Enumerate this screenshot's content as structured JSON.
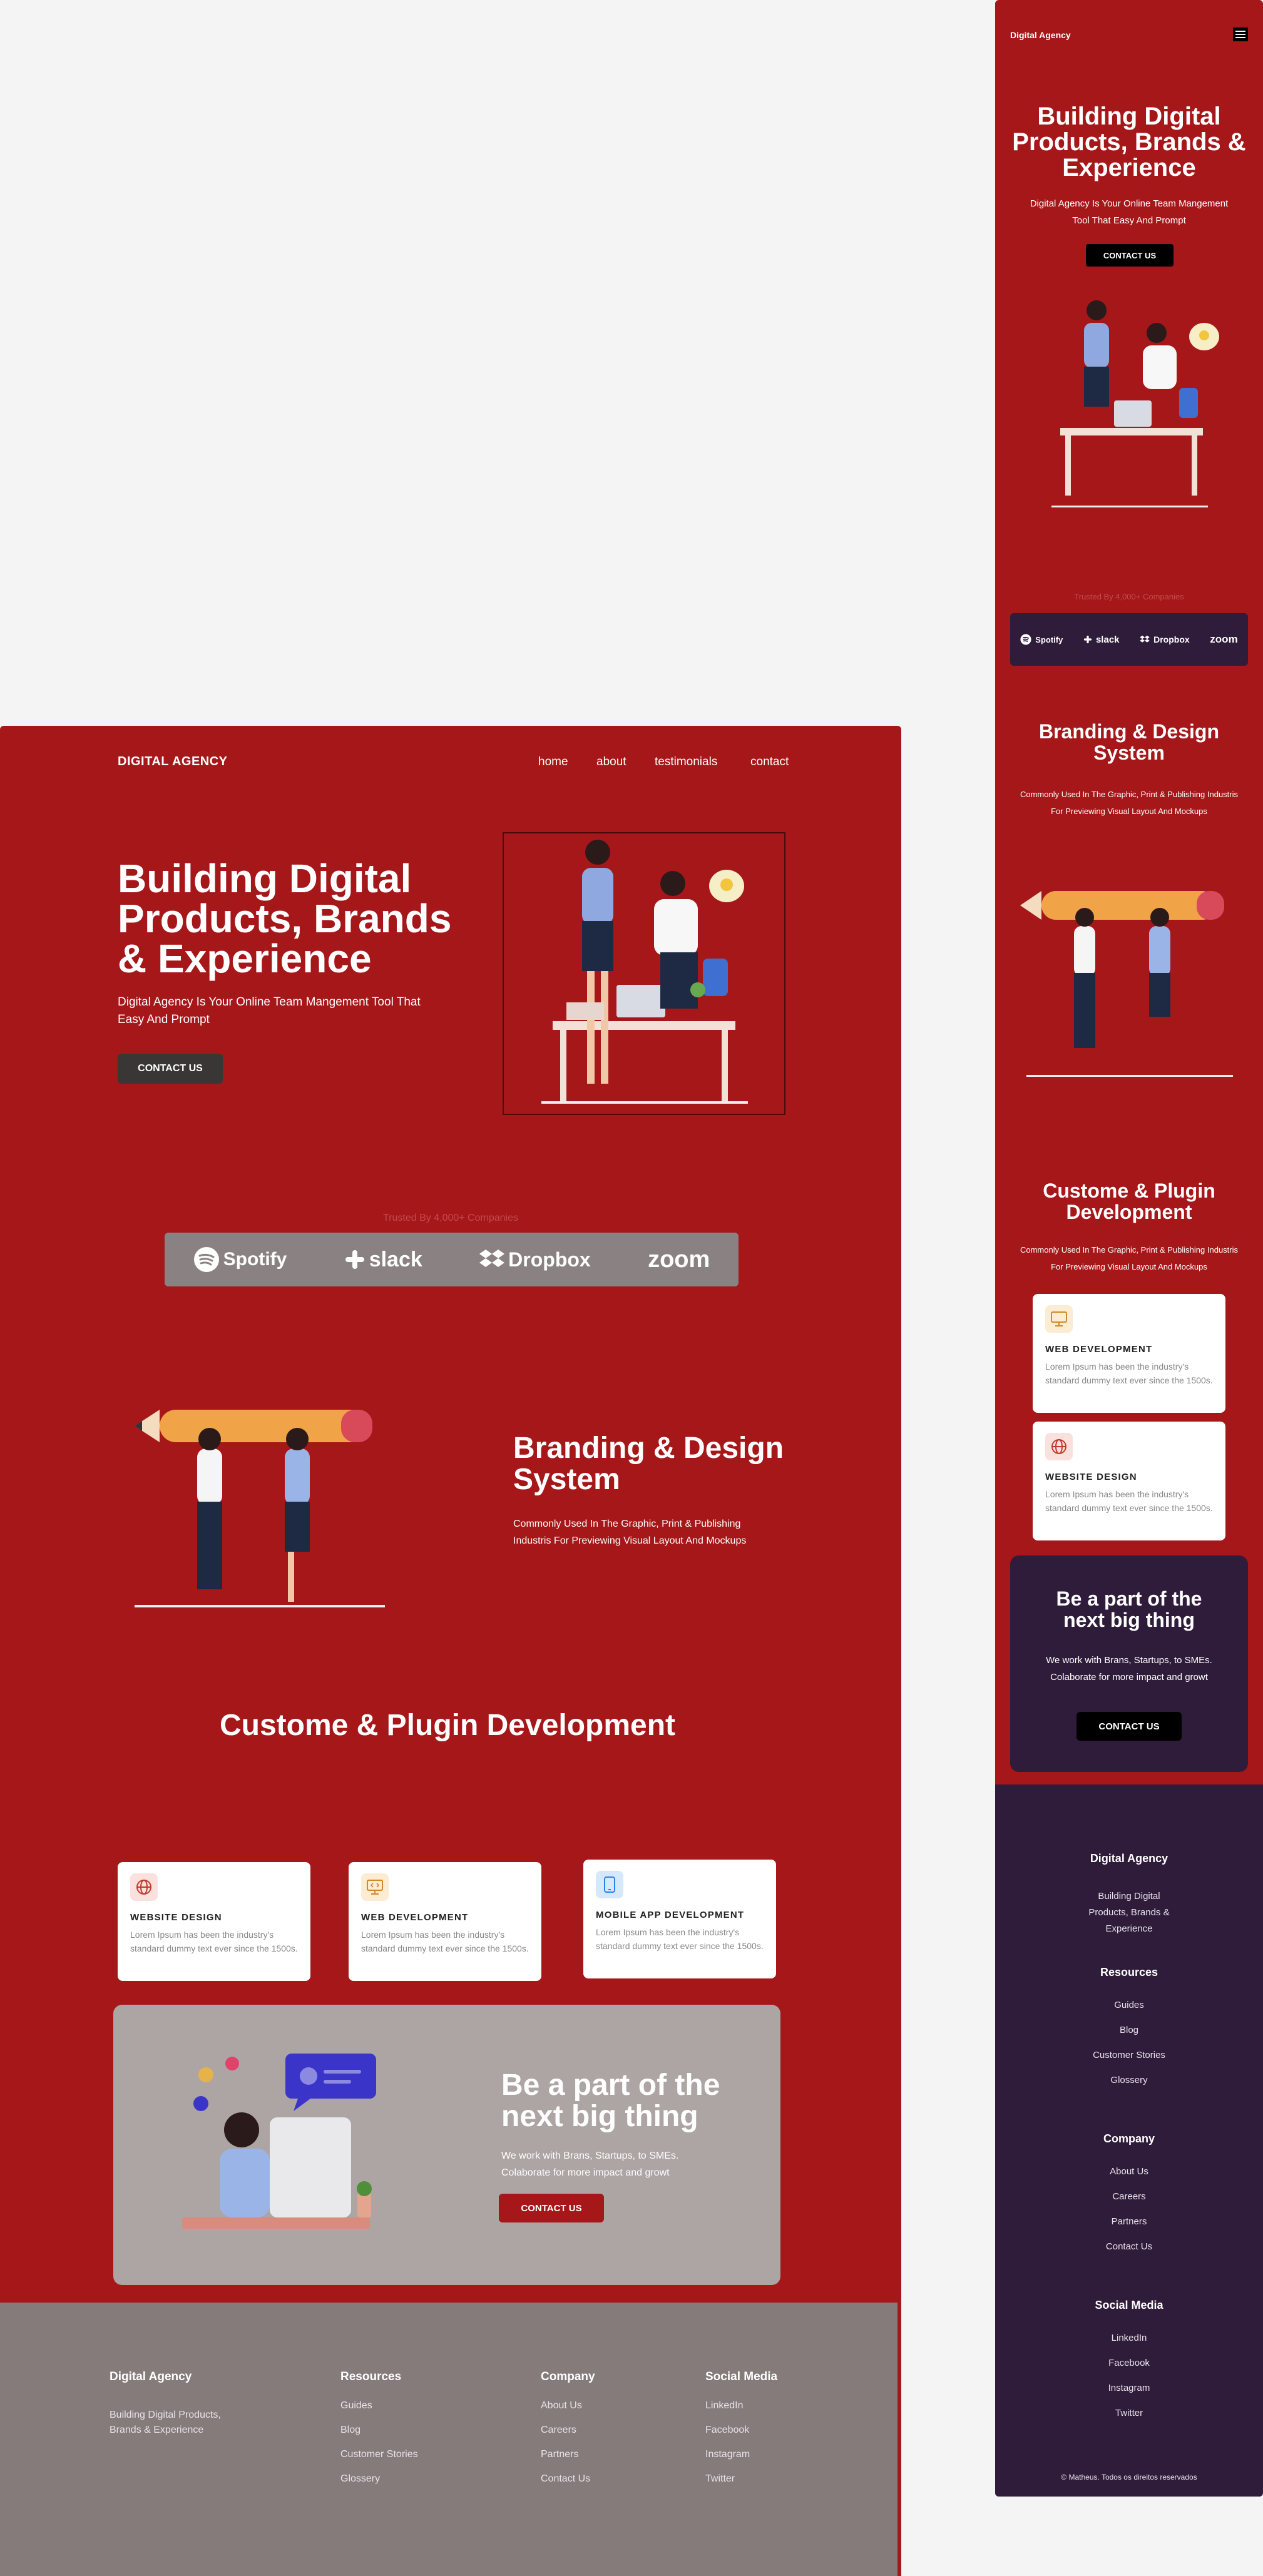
{
  "desktop": {
    "brand": "DIGITAL AGENCY",
    "nav": [
      "home",
      "about",
      "testimonials",
      "contact"
    ],
    "hero": {
      "title": "Building Digital Products, Brands & Experience",
      "subtitle": "Digital Agency Is Your Online Team Mangement Tool That Easy And Prompt",
      "cta": "CONTACT US"
    },
    "trusted": "Trusted By 4,000+ Companies",
    "logos": [
      "Spotify",
      "slack",
      "Dropbox",
      "zoom"
    ],
    "branding": {
      "title": "Branding & Design System",
      "text": "Commonly Used In The Graphic, Print & Publishing Industris For Previewing Visual Layout And Mockups"
    },
    "services_title": "Custome & Plugin Development",
    "cards": [
      {
        "title": "WEBSITE DESIGN",
        "text": "Lorem Ipsum has been the industry's standard dummy text ever since the 1500s."
      },
      {
        "title": "WEB DEVELOPMENT",
        "text": "Lorem Ipsum has been the industry's standard dummy text ever since the 1500s."
      },
      {
        "title": "MOBILE APP DEVELOPMENT",
        "text": "Lorem Ipsum has been the industry's standard dummy text ever since the 1500s."
      }
    ],
    "cta_block": {
      "title": "Be a part of the next big thing",
      "text": "We work with Brans, Startups, to SMEs. Colaborate for more impact and growt",
      "button": "CONTACT US"
    },
    "footer": {
      "brand": "Digital Agency",
      "tagline": "Building Digital Products, Brands & Experience",
      "columns": [
        {
          "title": "Resources",
          "links": [
            "Guides",
            "Blog",
            "Customer Stories",
            "Glossery"
          ]
        },
        {
          "title": "Company",
          "links": [
            "About Us",
            "Careers",
            "Partners",
            "Contact Us"
          ]
        },
        {
          "title": "Social Media",
          "links": [
            "LinkedIn",
            "Facebook",
            "Instagram",
            "Twitter"
          ]
        }
      ]
    }
  },
  "mobile": {
    "brand": "Digital Agency",
    "hero": {
      "title": "Building Digital Products, Brands & Experience",
      "subtitle": "Digital Agency Is Your Online Team Mangement Tool That Easy And Prompt",
      "cta": "CONTACT US"
    },
    "trusted": "Trusted By 4,000+ Companies",
    "logos": [
      "Spotify",
      "slack",
      "Dropbox",
      "zoom"
    ],
    "branding": {
      "title": "Branding & Design System",
      "text": "Commonly Used In The Graphic, Print & Publishing Industris For Previewing Visual Layout And Mockups"
    },
    "services": {
      "title": "Custome & Plugin Development",
      "text": "Commonly Used In The Graphic, Print & Publishing Industris For Previewing Visual Layout And Mockups"
    },
    "cards": [
      {
        "title": "WEB DEVELOPMENT",
        "text": "Lorem Ipsum has been the industry's standard dummy text ever since the 1500s."
      },
      {
        "title": "WEBSITE DESIGN",
        "text": "Lorem Ipsum has been the industry's standard dummy text ever since the 1500s."
      }
    ],
    "cta_block": {
      "title": "Be a part of the next big thing",
      "text": "We work with Brans, Startups, to SMEs. Colaborate for more impact and growt",
      "button": "CONTACT US"
    },
    "footer": {
      "brand": "Digital Agency",
      "tagline": "Building Digital Products, Brands & Experience",
      "columns": [
        {
          "title": "Resources",
          "links": [
            "Guides",
            "Blog",
            "Customer Stories",
            "Glossery"
          ]
        },
        {
          "title": "Company",
          "links": [
            "About Us",
            "Careers",
            "Partners",
            "Contact Us"
          ]
        },
        {
          "title": "Social Media",
          "links": [
            "LinkedIn",
            "Facebook",
            "Instagram",
            "Twitter"
          ]
        }
      ],
      "copyright": "© Matheus. Todos os direitos reservados"
    }
  },
  "colors": {
    "brand_red": "#a51719",
    "dark_purple": "#2f1b3a",
    "footer_gray": "#857b7b",
    "cta_gray": "#ada4a4"
  },
  "icons": [
    "hamburger-menu-icon",
    "globe-icon",
    "monitor-code-icon",
    "mobile-app-icon",
    "spotify-logo",
    "slack-logo",
    "dropbox-logo",
    "zoom-logo"
  ]
}
